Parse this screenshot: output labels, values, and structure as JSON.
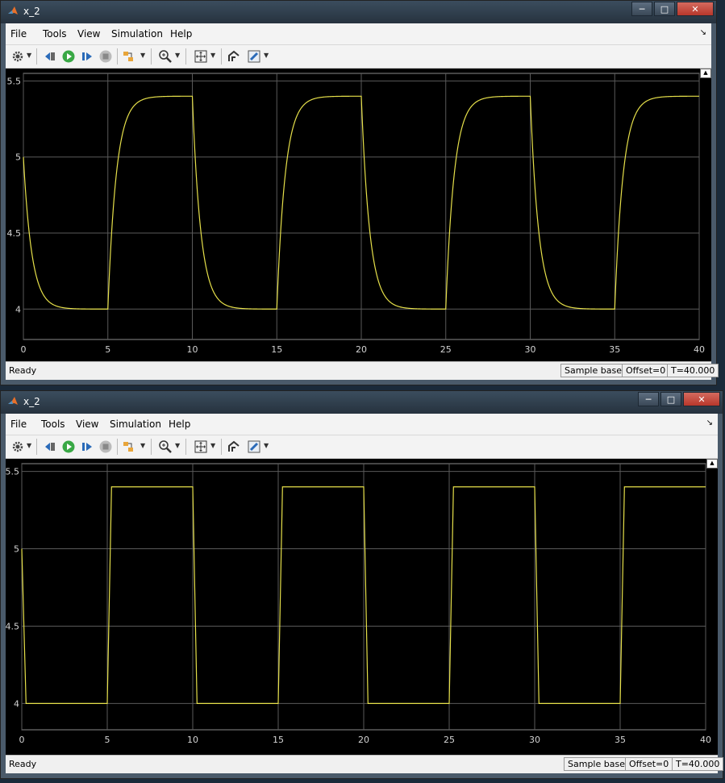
{
  "windows": [
    {
      "title": "x_2",
      "menu": [
        "File",
        "Tools",
        "View",
        "Simulation",
        "Help"
      ],
      "status": {
        "ready": "Ready",
        "sample": "Sample based",
        "offset": "Offset=0",
        "time": "T=40.000"
      }
    },
    {
      "title": "x_2",
      "menu": [
        "File",
        "Tools",
        "View",
        "Simulation",
        "Help"
      ],
      "status": {
        "ready": "Ready",
        "sample": "Sample based",
        "offset": "Offset=0",
        "time": "T=40.000"
      }
    }
  ],
  "icons": {
    "title": "matlab-logo-icon",
    "toolbar": [
      "settings-gear-icon",
      "step-back-icon",
      "run-icon",
      "step-forward-icon",
      "stop-icon",
      "highlight-block-icon",
      "zoom-in-icon",
      "fit-to-view-icon",
      "restore-view-icon",
      "style-pen-icon"
    ]
  },
  "colors": {
    "trace": "#e6e04a",
    "background": "#000000",
    "grid": "#5a5a5a",
    "axis_text": "#d4d4d4"
  },
  "chart_data": [
    {
      "type": "line",
      "title": "",
      "xlabel": "",
      "ylabel": "",
      "xlim": [
        0,
        40
      ],
      "ylim": [
        3.8,
        5.55
      ],
      "xticks": [
        "0",
        "5",
        "10",
        "15",
        "20",
        "25",
        "30",
        "35",
        "40"
      ],
      "yticks": [
        "4",
        "4.5",
        "5",
        "5.5"
      ],
      "grid": true,
      "series": [
        {
          "shape": "first-order exponential square wave",
          "low": 4.0,
          "high": 5.4,
          "period": 10,
          "rise_at": [
            5,
            15,
            25,
            35
          ],
          "fall_at": [
            10,
            20,
            30
          ],
          "time_constant": 0.5,
          "initial": 5.0
        }
      ]
    },
    {
      "type": "line",
      "title": "",
      "xlabel": "",
      "ylabel": "",
      "xlim": [
        0,
        40
      ],
      "ylim": [
        3.83,
        5.55
      ],
      "xticks": [
        "0",
        "5",
        "10",
        "15",
        "20",
        "25",
        "30",
        "35",
        "40"
      ],
      "yticks": [
        "4",
        "4.5",
        "5",
        "5.5"
      ],
      "grid": true,
      "series": [
        {
          "shape": "near-square wave",
          "low": 4.0,
          "high": 5.4,
          "period": 10,
          "rise_at": [
            5,
            15,
            25,
            35
          ],
          "fall_at": [
            10,
            20,
            30
          ],
          "transition_time": 0.25,
          "initial": 5.0
        }
      ]
    }
  ]
}
